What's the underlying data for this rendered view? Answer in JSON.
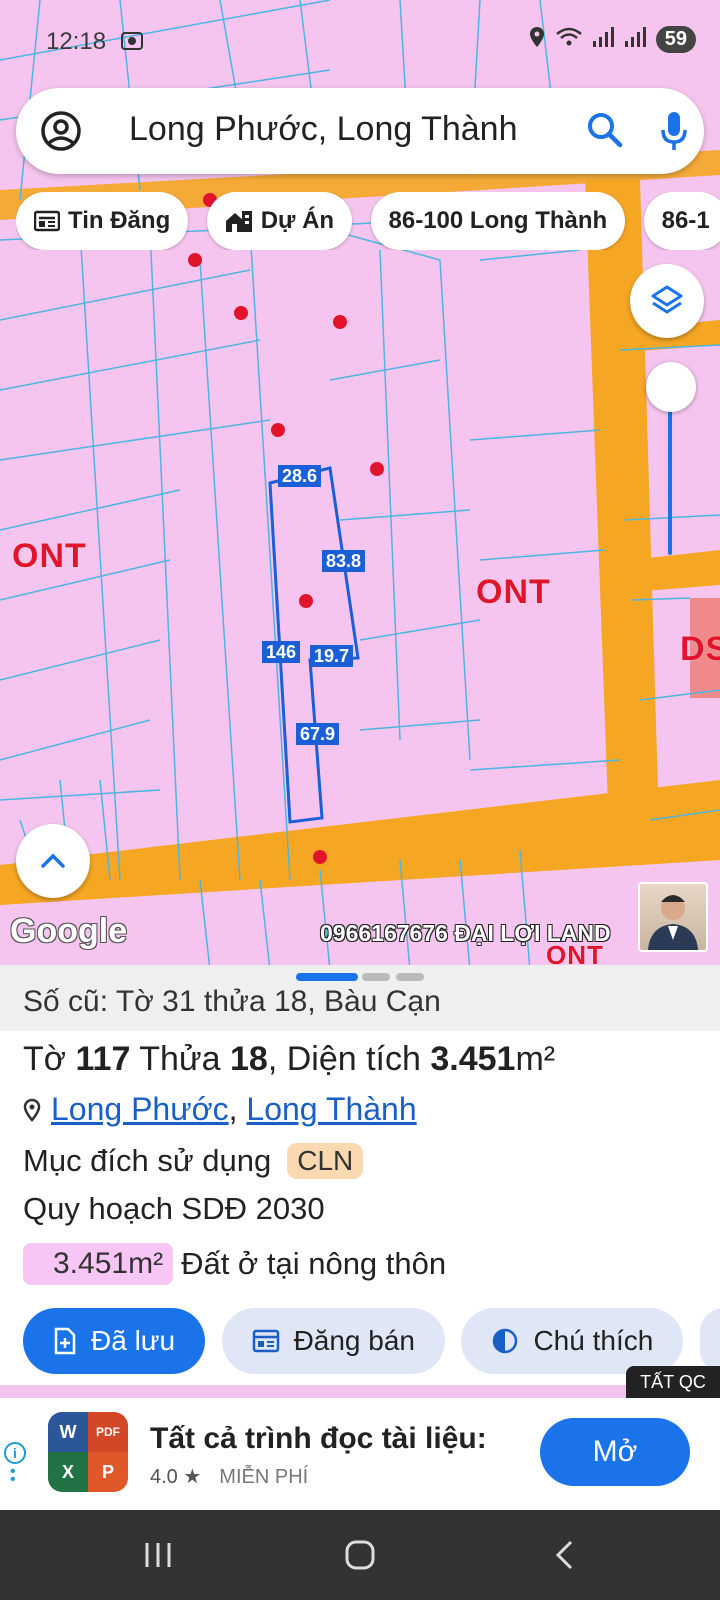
{
  "status": {
    "time": "12:18",
    "battery": "59"
  },
  "search": {
    "query": "Long Phước, Long Thành"
  },
  "chips": [
    {
      "label": "Tin Đăng",
      "icon": "newspaper-icon"
    },
    {
      "label": "Dự Án",
      "icon": "buildings-icon"
    },
    {
      "label": "86-100 Long Thành",
      "icon": ""
    },
    {
      "label": "86-1",
      "icon": ""
    }
  ],
  "map": {
    "zones": [
      "ONT",
      "ONT",
      "DS",
      "ONT"
    ],
    "dimensions": [
      "28.6",
      "83.8",
      "146",
      "19.7",
      "67.9"
    ],
    "google_label": "Google",
    "watermark": "0966167676 ĐẠI LỢI LAND"
  },
  "sheet": {
    "old_ref": "Số cũ: Tờ 31 thửa 18, Bàu Cạn",
    "parcel": {
      "to_label": "Tờ ",
      "to_value": "117",
      "thua_label": " Thửa ",
      "thua_value": "18",
      "area_label": ", Diện tích ",
      "area_value": "3.451",
      "area_unit": "m²"
    },
    "location": {
      "commune": "Long Phước",
      "separator": ",",
      "district": "Long Thành"
    },
    "purpose_label": "Mục đích sử dụng",
    "purpose_code": "CLN",
    "plan_label": "Quy hoạch SDĐ 2030",
    "plan_area": "3.451m²",
    "plan_area_text": "Đất ở tại nông thôn",
    "actions": [
      {
        "label": "Đã lưu",
        "icon": "saved-doc-icon",
        "primary": true
      },
      {
        "label": "Đăng bán",
        "icon": "listing-icon",
        "primary": false
      },
      {
        "label": "Chú thích",
        "icon": "contrast-icon",
        "primary": false
      }
    ]
  },
  "ad": {
    "tag": "TẤT QC",
    "title": "Tất cả trình đọc tài liệu:",
    "rating": "4.0 ★",
    "price": "MIỄN PHÍ",
    "cta": "Mở"
  },
  "colors": {
    "accent": "#1a73e8",
    "map_bg": "#f6c5ef",
    "road": "#f5a623",
    "zone_text": "#e0142b"
  }
}
